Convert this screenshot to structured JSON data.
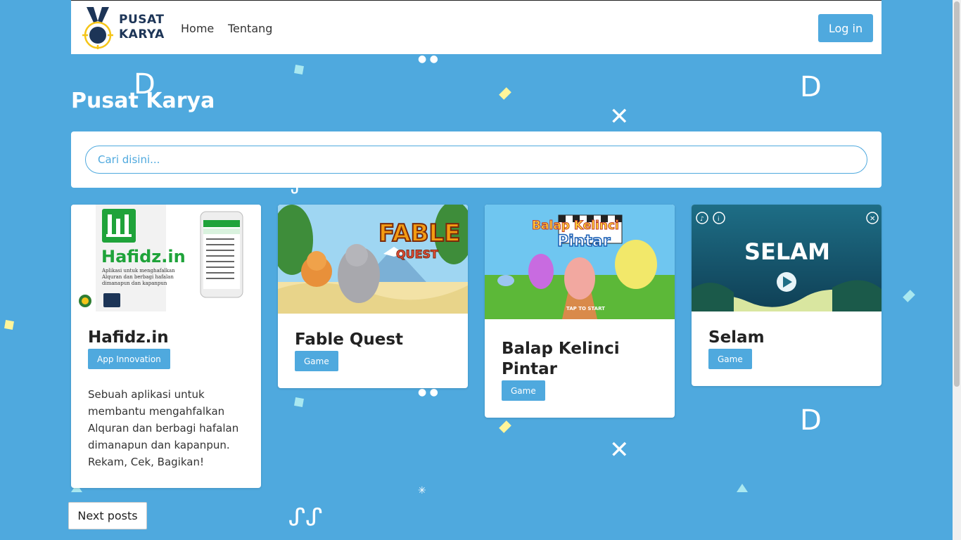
{
  "brand": {
    "line1": "PUSAT",
    "line2": "KARYA"
  },
  "nav": {
    "home": "Home",
    "about": "Tentang",
    "login": "Log in"
  },
  "page": {
    "title": "Pusat Karya"
  },
  "search": {
    "placeholder": "Cari disini..."
  },
  "cards": [
    {
      "title": "Hafidz.in",
      "category": "App Innovation",
      "description": "Sebuah aplikasi untuk membantu mengahfalkan Alquran dan berbagi hafalan dimanapun dan kapanpun. Rekam, Cek, Bagikan!",
      "image": {
        "brand": "Hafidz.in",
        "caption": "Aplikasi untuk menghafalkan Alquran dan berbagi hafalan dimanapun dan kapanpun"
      }
    },
    {
      "title": "Fable Quest",
      "category": "Game",
      "image": {
        "logo_line1": "FABLE",
        "logo_line2": "QUEST"
      }
    },
    {
      "title": "Balap Kelinci Pintar",
      "category": "Game",
      "image": {
        "logo_line1": "Balap Kelinci",
        "logo_line2": "Pintar",
        "tap": "TAP TO START"
      }
    },
    {
      "title": "Selam",
      "category": "Game",
      "image": {
        "logo": "SELAM"
      }
    }
  ],
  "pagination": {
    "next": "Next posts"
  },
  "colors": {
    "background": "#4fa9de",
    "accent": "#4fa9de",
    "brand_dark": "#1d3557",
    "medal_yellow": "#f5c518"
  }
}
